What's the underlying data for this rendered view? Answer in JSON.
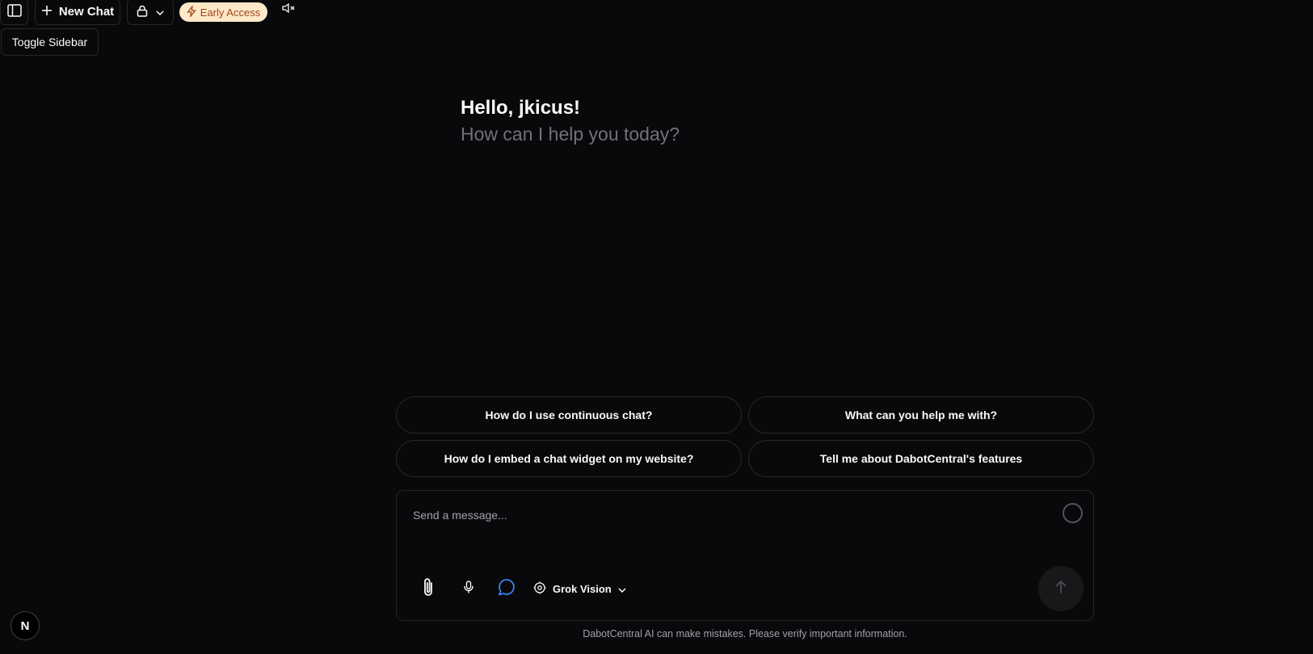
{
  "topbar": {
    "new_chat_label": "New Chat",
    "early_access_label": "Early Access",
    "tooltip": "Toggle Sidebar"
  },
  "greeting": {
    "hello": "Hello, jkicus!",
    "subtitle": "How can I help you today?"
  },
  "suggestions": [
    "How do I use continuous chat?",
    "What can you help me with?",
    "How do I embed a chat widget on my website?",
    "Tell me about DabotCentral's features"
  ],
  "composer": {
    "placeholder": "Send a message...",
    "model": "Grok Vision"
  },
  "disclaimer": "DabotCentral AI can make mistakes. Please verify important information.",
  "badge": "N",
  "colors": {
    "background": "#09090b",
    "border": "#27272a",
    "muted_text": "#71717a",
    "early_access_bg": "#fde8c8",
    "early_access_text": "#a0471a",
    "chat_mode_accent": "#3b82f6"
  }
}
